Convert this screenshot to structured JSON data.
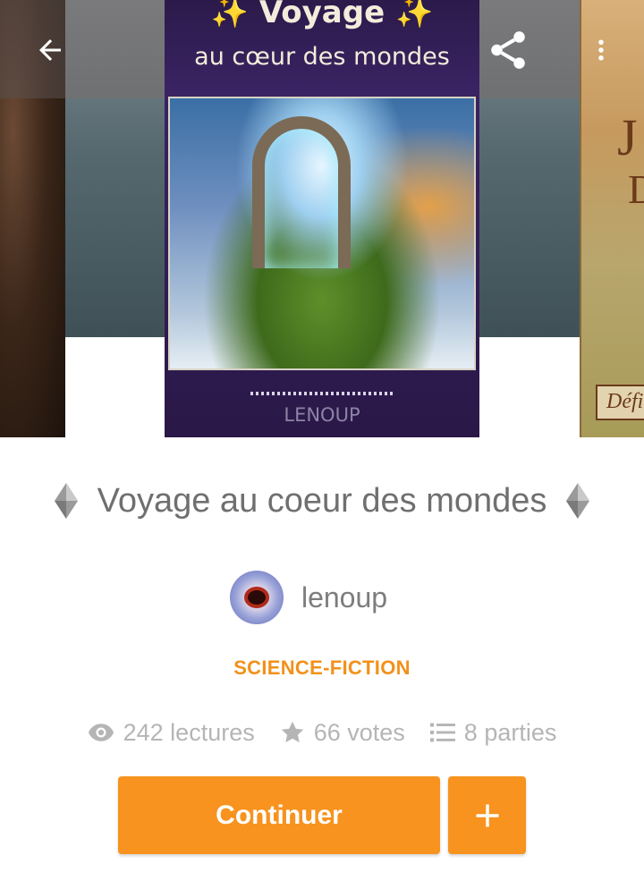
{
  "cover": {
    "title": "✨ Voyage ✨",
    "subtitle": "au cœur des mondes",
    "author": "LENOUP"
  },
  "next_cover": {
    "letter_top": "J",
    "letter_bottom": "D",
    "caption": "Défi"
  },
  "toolbar": {
    "back_icon": "arrow-left-icon",
    "share_icon": "share-icon",
    "menu_icon": "more-vertical-icon"
  },
  "story": {
    "title": "Voyage au coeur des mondes",
    "title_decoration": "diamond-icon"
  },
  "author": {
    "name": "lenoup"
  },
  "genre": "SCIENCE-FICTION",
  "stats": {
    "reads": "242 lectures",
    "votes": "66 votes",
    "parts": "8 parties"
  },
  "actions": {
    "continue_label": "Continuer",
    "add_label": "+"
  },
  "colors": {
    "accent": "#f7931e",
    "genre": "#f2911b",
    "title_text": "#6f6f6f",
    "stat_text": "#b5b5b5"
  }
}
